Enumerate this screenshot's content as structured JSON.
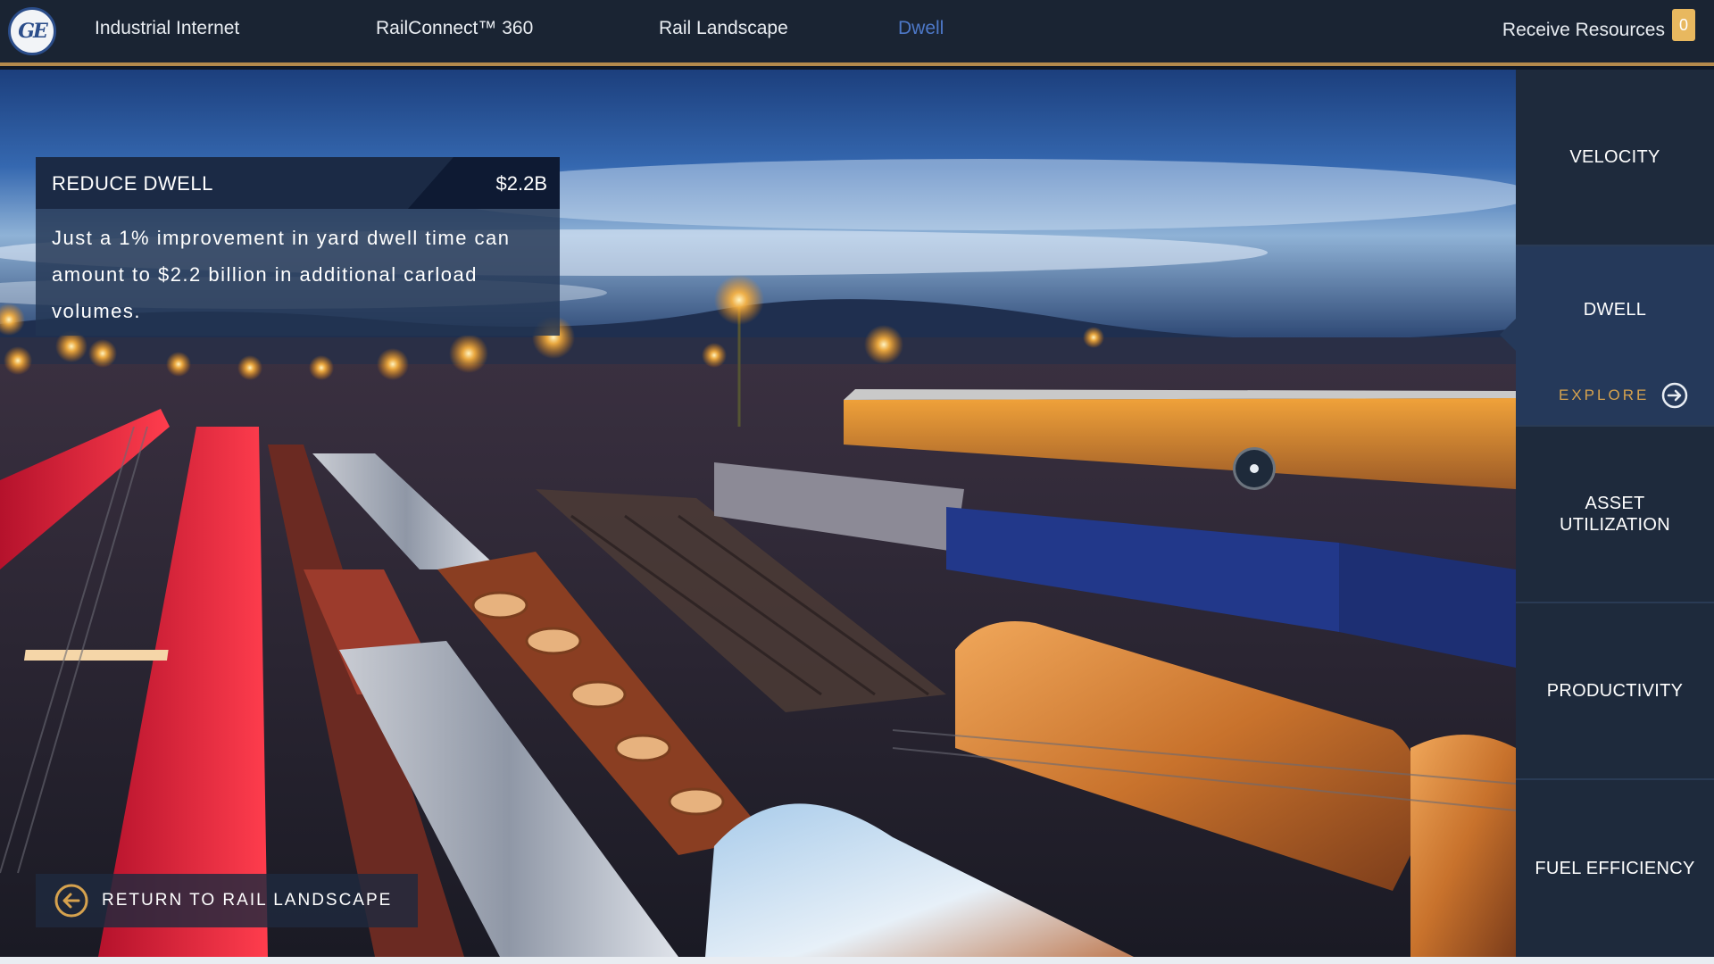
{
  "nav": {
    "items": [
      "Industrial Internet",
      "RailConnect™ 360",
      "Rail Landscape",
      "Dwell"
    ],
    "active_index": 3,
    "resources_label": "Receive Resources",
    "resources_count": "0"
  },
  "card": {
    "title": "REDUCE DWELL",
    "value": "$2.2B",
    "body": "Just a 1% improvement in yard dwell time can amount to $2.2 billion in additional carload volumes."
  },
  "return_label": "RETURN TO RAIL LANDSCAPE",
  "sidebar": {
    "items": [
      "VELOCITY",
      "DWELL",
      "ASSET UTILIZATION",
      "PRODUCTIVITY",
      "FUEL EFFICIENCY"
    ],
    "active_index": 1,
    "explore_label": "EXPLORE"
  },
  "colors": {
    "nav_bg": "#1a2433",
    "accent_gold": "#d6a24e",
    "active_blue": "#4d78c8",
    "sidebar_bg": "#1e2a3c"
  },
  "icons": [
    "ge-logo",
    "arrow-left-circle-icon",
    "arrow-right-circle-icon",
    "hotspot-icon"
  ]
}
